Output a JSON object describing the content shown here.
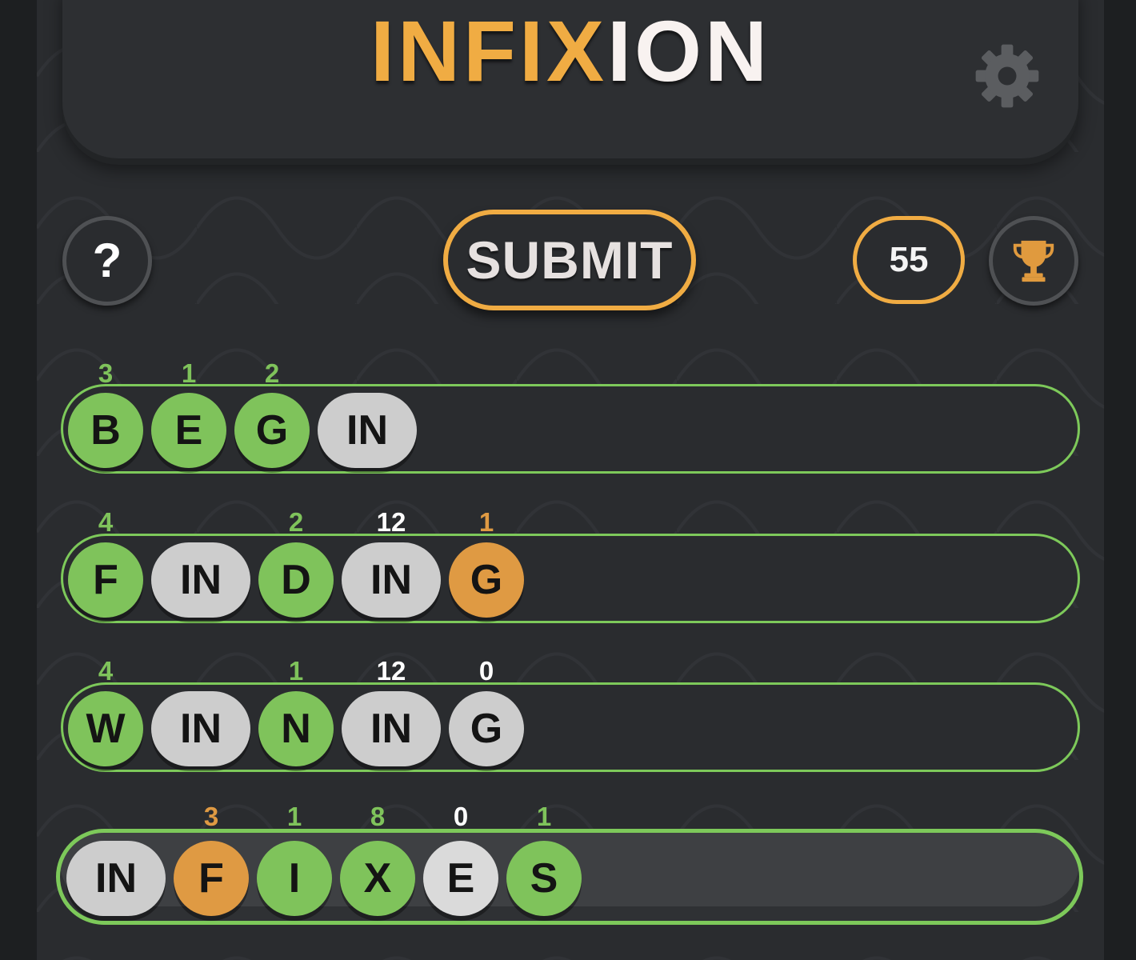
{
  "header": {
    "title_orange": "INFIX",
    "title_white": "ION",
    "settings_icon": "gear-icon"
  },
  "controls": {
    "help_label": "?",
    "submit_label": "SUBMIT",
    "score": "55",
    "trophy_icon": "trophy-icon"
  },
  "colors": {
    "green": "#7fc35b",
    "orange": "#df9a43",
    "gray": "#cdcdcd",
    "brand_orange": "#f0ac43"
  },
  "rows": [
    {
      "word": "BEGIN",
      "tiles": [
        {
          "text": "B",
          "color": "green",
          "count": "3",
          "count_color": "green"
        },
        {
          "text": "E",
          "color": "green",
          "count": "1",
          "count_color": "green"
        },
        {
          "text": "G",
          "color": "green",
          "count": "2",
          "count_color": "green"
        },
        {
          "text": "IN",
          "color": "gray",
          "count": "",
          "count_color": ""
        }
      ]
    },
    {
      "word": "FINDING",
      "tiles": [
        {
          "text": "F",
          "color": "green",
          "count": "4",
          "count_color": "green"
        },
        {
          "text": "IN",
          "color": "gray",
          "count": "",
          "count_color": ""
        },
        {
          "text": "D",
          "color": "green",
          "count": "2",
          "count_color": "green"
        },
        {
          "text": "IN",
          "color": "gray",
          "count": "12",
          "count_color": "white"
        },
        {
          "text": "G",
          "color": "orange",
          "count": "1",
          "count_color": "orange"
        }
      ]
    },
    {
      "word": "WINNING",
      "tiles": [
        {
          "text": "W",
          "color": "green",
          "count": "4",
          "count_color": "green"
        },
        {
          "text": "IN",
          "color": "gray",
          "count": "",
          "count_color": ""
        },
        {
          "text": "N",
          "color": "green",
          "count": "1",
          "count_color": "green"
        },
        {
          "text": "IN",
          "color": "gray",
          "count": "12",
          "count_color": "white"
        },
        {
          "text": "G",
          "color": "gray",
          "count": "0",
          "count_color": "white"
        }
      ]
    },
    {
      "word": "INFIXES",
      "tiles": [
        {
          "text": "IN",
          "color": "gray",
          "count": "",
          "count_color": ""
        },
        {
          "text": "F",
          "color": "orange",
          "count": "3",
          "count_color": "orange"
        },
        {
          "text": "I",
          "color": "green",
          "count": "1",
          "count_color": "green"
        },
        {
          "text": "X",
          "color": "green",
          "count": "8",
          "count_color": "green"
        },
        {
          "text": "E",
          "color": "light",
          "count": "0",
          "count_color": "white"
        },
        {
          "text": "S",
          "color": "green",
          "count": "1",
          "count_color": "green"
        }
      ]
    }
  ]
}
